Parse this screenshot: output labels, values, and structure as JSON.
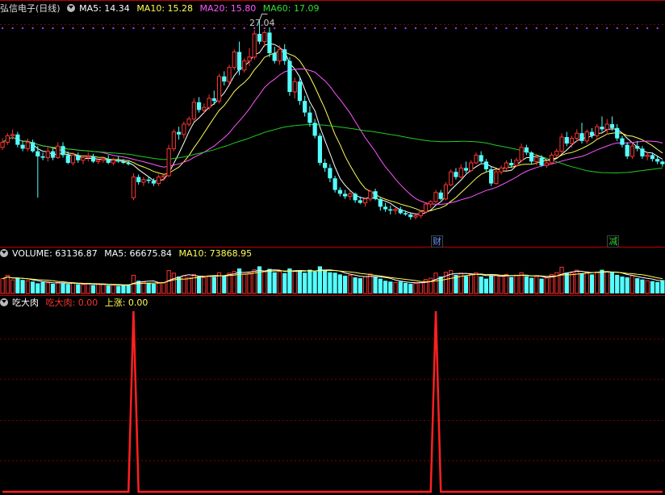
{
  "colors": {
    "up": "#ff3333",
    "down": "#54ffff",
    "ma5": "#ffffff",
    "ma10": "#ffff55",
    "ma20": "#ff55ff",
    "ma60": "#22cc22",
    "signal": "#ff2020",
    "grid": "#7a0000",
    "divider": "#c00000"
  },
  "price_panel": {
    "stock_name": "弘信电子",
    "period": "(日线)",
    "ma5_label": "MA5: 14.34",
    "ma10_label": "MA10: 15.28",
    "ma20_label": "MA20: 15.80",
    "ma60_label": "MA60: 17.09",
    "high_marker": "27.04",
    "events": [
      {
        "label": "财",
        "color": "#6699ff",
        "day": 86
      },
      {
        "label": "减",
        "color": "#33cc33",
        "day": 121
      }
    ]
  },
  "volume_panel": {
    "title": "VOLUME: 63136.87",
    "ma5_label": "MA5: 66675.84",
    "ma10_label": "MA10: 73868.95"
  },
  "indicator_panel": {
    "title": "吃大肉",
    "value1_label": "吃大肉: 0.00",
    "value2_label": "上涨: 0.00"
  },
  "chart_data": {
    "type": "candlestick",
    "price_range": [
      11.0,
      27.5
    ],
    "candles": [
      [
        17.2,
        17.9,
        17.0,
        17.6
      ],
      [
        17.6,
        18.3,
        17.4,
        18.1
      ],
      [
        18.1,
        18.6,
        17.8,
        18.2
      ],
      [
        18.2,
        18.4,
        17.2,
        17.4
      ],
      [
        17.4,
        17.7,
        16.9,
        17.1
      ],
      [
        17.1,
        17.9,
        16.9,
        17.6
      ],
      [
        17.6,
        17.8,
        16.8,
        16.9
      ],
      [
        16.9,
        17.3,
        13.3,
        16.5
      ],
      [
        16.5,
        16.8,
        16.2,
        16.4
      ],
      [
        16.4,
        17.2,
        16.1,
        16.9
      ],
      [
        16.9,
        17.1,
        16.2,
        16.4
      ],
      [
        16.4,
        17.6,
        16.3,
        17.3
      ],
      [
        17.3,
        17.6,
        16.4,
        16.6
      ],
      [
        16.6,
        16.9,
        15.9,
        16.0
      ],
      [
        16.0,
        16.8,
        15.8,
        16.6
      ],
      [
        16.6,
        16.8,
        16.0,
        16.2
      ],
      [
        16.2,
        16.6,
        15.9,
        16.4
      ],
      [
        16.4,
        16.8,
        16.1,
        16.5
      ],
      [
        16.5,
        16.7,
        16.0,
        16.1
      ],
      [
        16.1,
        16.3,
        15.9,
        16.2
      ],
      [
        16.2,
        16.5,
        16.0,
        16.3
      ],
      [
        16.3,
        16.6,
        15.9,
        16.0
      ],
      [
        16.0,
        16.4,
        15.8,
        16.2
      ],
      [
        16.2,
        16.5,
        16.0,
        16.1
      ],
      [
        16.1,
        16.3,
        15.9,
        16.0
      ],
      [
        16.0,
        16.2,
        15.8,
        15.9
      ],
      [
        13.3,
        15.2,
        13.1,
        14.9
      ],
      [
        14.9,
        15.1,
        14.3,
        14.5
      ],
      [
        14.5,
        14.9,
        14.2,
        14.7
      ],
      [
        14.7,
        14.9,
        14.4,
        14.6
      ],
      [
        14.6,
        14.8,
        14.2,
        14.4
      ],
      [
        14.4,
        15.1,
        14.2,
        14.9
      ],
      [
        14.9,
        15.2,
        14.6,
        15.0
      ],
      [
        15.0,
        17.4,
        14.9,
        17.1
      ],
      [
        17.1,
        18.6,
        16.9,
        18.4
      ],
      [
        18.4,
        18.8,
        17.8,
        18.2
      ],
      [
        18.2,
        19.2,
        17.9,
        19.0
      ],
      [
        19.0,
        19.6,
        18.8,
        19.4
      ],
      [
        19.4,
        21.0,
        19.2,
        20.7
      ],
      [
        20.7,
        21.1,
        19.9,
        20.1
      ],
      [
        20.1,
        20.6,
        19.8,
        20.3
      ],
      [
        20.3,
        21.3,
        20.1,
        21.0
      ],
      [
        21.0,
        21.6,
        20.5,
        20.8
      ],
      [
        20.8,
        22.9,
        20.6,
        22.7
      ],
      [
        22.7,
        23.1,
        22.0,
        22.3
      ],
      [
        22.3,
        23.6,
        22.1,
        23.4
      ],
      [
        23.4,
        24.8,
        23.2,
        24.6
      ],
      [
        24.6,
        25.4,
        22.8,
        23.2
      ],
      [
        23.2,
        24.1,
        23.0,
        23.9
      ],
      [
        23.9,
        24.9,
        23.5,
        24.2
      ],
      [
        24.2,
        26.3,
        24.0,
        26.0
      ],
      [
        26.0,
        27.04,
        25.2,
        25.4
      ],
      [
        25.4,
        26.3,
        25.0,
        26.1
      ],
      [
        26.1,
        26.5,
        24.2,
        24.5
      ],
      [
        24.5,
        25.0,
        23.7,
        23.9
      ],
      [
        23.9,
        25.1,
        23.6,
        24.8
      ],
      [
        24.8,
        25.2,
        23.6,
        23.9
      ],
      [
        23.9,
        24.2,
        21.2,
        21.5
      ],
      [
        21.5,
        22.6,
        21.0,
        22.3
      ],
      [
        22.3,
        22.7,
        20.5,
        20.8
      ],
      [
        20.8,
        21.2,
        19.6,
        19.9
      ],
      [
        19.9,
        20.4,
        18.8,
        19.1
      ],
      [
        19.1,
        19.4,
        17.9,
        18.1
      ],
      [
        18.1,
        18.3,
        15.8,
        16.0
      ],
      [
        16.0,
        16.3,
        15.3,
        15.6
      ],
      [
        15.6,
        15.9,
        14.5,
        14.8
      ],
      [
        14.8,
        15.0,
        13.7,
        13.9
      ],
      [
        13.9,
        14.1,
        13.4,
        13.6
      ],
      [
        13.6,
        13.9,
        13.2,
        13.4
      ],
      [
        13.4,
        13.8,
        13.1,
        13.6
      ],
      [
        13.6,
        13.7,
        12.9,
        13.1
      ],
      [
        13.1,
        13.4,
        12.8,
        12.9
      ],
      [
        12.9,
        13.3,
        12.6,
        13.2
      ],
      [
        13.2,
        13.9,
        13.0,
        13.8
      ],
      [
        13.8,
        14.0,
        13.1,
        13.2
      ],
      [
        13.2,
        13.3,
        12.3,
        12.6
      ],
      [
        12.6,
        12.9,
        12.2,
        12.4
      ],
      [
        12.4,
        12.7,
        12.0,
        12.3
      ],
      [
        12.3,
        12.5,
        12.0,
        12.4
      ],
      [
        12.4,
        12.6,
        12.0,
        12.1
      ],
      [
        12.1,
        12.3,
        11.9,
        12.0
      ],
      [
        12.0,
        12.1,
        11.6,
        11.8
      ],
      [
        11.8,
        12.0,
        11.6,
        11.9
      ],
      [
        11.9,
        12.3,
        11.7,
        12.2
      ],
      [
        12.2,
        12.9,
        12.1,
        12.8
      ],
      [
        12.8,
        13.1,
        12.5,
        13.0
      ],
      [
        13.0,
        13.9,
        12.9,
        13.7
      ],
      [
        13.7,
        13.9,
        13.1,
        13.2
      ],
      [
        13.2,
        14.5,
        13.1,
        14.3
      ],
      [
        14.3,
        15.5,
        14.2,
        15.3
      ],
      [
        15.3,
        15.6,
        14.7,
        14.9
      ],
      [
        14.9,
        15.9,
        14.8,
        15.6
      ],
      [
        15.6,
        16.1,
        15.2,
        15.4
      ],
      [
        15.4,
        16.2,
        15.3,
        16.0
      ],
      [
        16.0,
        16.8,
        15.9,
        16.6
      ],
      [
        16.6,
        16.9,
        16.0,
        16.1
      ],
      [
        16.1,
        16.3,
        15.3,
        15.5
      ],
      [
        15.5,
        15.7,
        14.2,
        14.4
      ],
      [
        14.4,
        15.5,
        14.3,
        15.3
      ],
      [
        15.3,
        15.8,
        15.1,
        15.6
      ],
      [
        15.6,
        16.2,
        15.4,
        16.0
      ],
      [
        16.0,
        16.3,
        15.6,
        15.8
      ],
      [
        15.8,
        16.4,
        15.7,
        16.2
      ],
      [
        16.2,
        17.5,
        16.1,
        17.2
      ],
      [
        17.2,
        17.4,
        16.6,
        16.8
      ],
      [
        16.8,
        16.9,
        15.9,
        16.1
      ],
      [
        16.1,
        16.7,
        15.8,
        16.4
      ],
      [
        16.4,
        16.6,
        15.7,
        15.8
      ],
      [
        15.8,
        16.2,
        15.6,
        16.0
      ],
      [
        16.0,
        16.8,
        15.9,
        16.6
      ],
      [
        16.6,
        17.1,
        16.4,
        16.9
      ],
      [
        16.9,
        18.3,
        16.7,
        18.0
      ],
      [
        18.0,
        18.4,
        17.3,
        17.5
      ],
      [
        17.5,
        18.1,
        17.2,
        17.9
      ],
      [
        17.9,
        18.6,
        17.6,
        18.3
      ],
      [
        18.3,
        19.1,
        17.5,
        17.7
      ],
      [
        17.7,
        18.6,
        17.5,
        18.4
      ],
      [
        18.4,
        18.7,
        17.9,
        18.1
      ],
      [
        18.1,
        19.0,
        17.9,
        18.8
      ],
      [
        18.8,
        19.6,
        18.4,
        18.6
      ],
      [
        18.6,
        19.4,
        18.2,
        19.0
      ],
      [
        19.0,
        19.6,
        18.5,
        18.7
      ],
      [
        18.7,
        19.0,
        17.7,
        17.9
      ],
      [
        17.9,
        18.1,
        17.2,
        17.4
      ],
      [
        17.4,
        17.6,
        16.3,
        16.5
      ],
      [
        16.5,
        17.6,
        16.3,
        17.3
      ],
      [
        17.3,
        17.7,
        16.9,
        17.1
      ],
      [
        17.1,
        17.3,
        16.3,
        16.5
      ],
      [
        16.5,
        16.8,
        16.2,
        16.6
      ],
      [
        16.6,
        16.8,
        16.1,
        16.3
      ],
      [
        16.3,
        16.5,
        15.9,
        16.1
      ],
      [
        16.1,
        16.2,
        15.7,
        15.9
      ]
    ],
    "ma5_last": 14.34,
    "ma10_last": 15.28,
    "ma20_last": 15.8,
    "ma60_last": 17.09,
    "volume_range": [
      0,
      160000
    ],
    "volume": [
      70000,
      86000,
      64000,
      74000,
      64000,
      60000,
      56000,
      48000,
      54000,
      50000,
      46000,
      52000,
      48000,
      45000,
      50000,
      44000,
      42000,
      46000,
      40000,
      44000,
      42000,
      38000,
      40000,
      36000,
      38000,
      42000,
      86000,
      60000,
      54000,
      50000,
      46000,
      48000,
      52000,
      108000,
      96000,
      80000,
      84000,
      76000,
      90000,
      80000,
      74000,
      84000,
      78000,
      98000,
      86000,
      96000,
      104000,
      118000,
      92000,
      96000,
      112000,
      128000,
      102000,
      116000,
      100000,
      104000,
      96000,
      118000,
      104000,
      110000,
      98000,
      112000,
      104000,
      128000,
      112000,
      100000,
      98000,
      90000,
      84000,
      86000,
      76000,
      72000,
      80000,
      92000,
      78000,
      70000,
      60000,
      56000,
      52000,
      56000,
      50000,
      46000,
      48000,
      52000,
      66000,
      72000,
      96000,
      80000,
      100000,
      108000,
      88000,
      96000,
      82000,
      90000,
      98000,
      80000,
      70000,
      86000,
      88000,
      82000,
      90000,
      78000,
      86000,
      98000,
      80000,
      74000,
      80000,
      70000,
      74000,
      90000,
      98000,
      124000,
      98000,
      96000,
      110000,
      96000,
      102000,
      90000,
      100000,
      112000,
      104000,
      100000,
      88000,
      80000,
      76000,
      84000,
      72000,
      66000,
      60000,
      58000,
      54000,
      63136.87
    ],
    "vol_ma5_last": 66675.84,
    "vol_ma10_last": 73868.95,
    "signal_range": [
      0,
      1
    ],
    "signal_spikes": [
      26,
      86
    ]
  }
}
